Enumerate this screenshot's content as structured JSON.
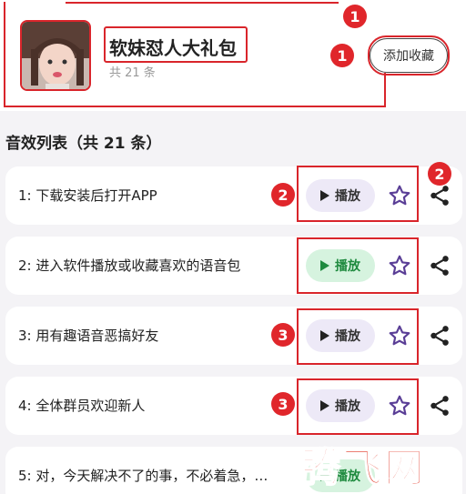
{
  "pack": {
    "title": "软妹怼人大礼包",
    "count": "共 21 条",
    "fav_label": "添加收藏"
  },
  "section_title": "音效列表（共 21 条）",
  "play_label": "播放",
  "rows": [
    {
      "text": "1: 下载安装后打开APP",
      "state": "idle"
    },
    {
      "text": "2: 进入软件播放或收藏喜欢的语音包",
      "state": "active"
    },
    {
      "text": "3: 用有趣语音恶搞好友",
      "state": "idle"
    },
    {
      "text": "4: 全体群员欢迎新人",
      "state": "idle"
    },
    {
      "text": "5: 对，今天解决不了的事，不必着急，…",
      "state": "active"
    }
  ],
  "badges": [
    "1",
    "1",
    "2",
    "2",
    "3",
    "3"
  ],
  "watermark": "腾飞网",
  "colors": {
    "annotation": "#d9252b",
    "accent_purple": "#6b4aa8",
    "play_active_bg": "#d6f3df"
  },
  "icons": [
    "star-icon",
    "share-icon",
    "play-icon"
  ]
}
